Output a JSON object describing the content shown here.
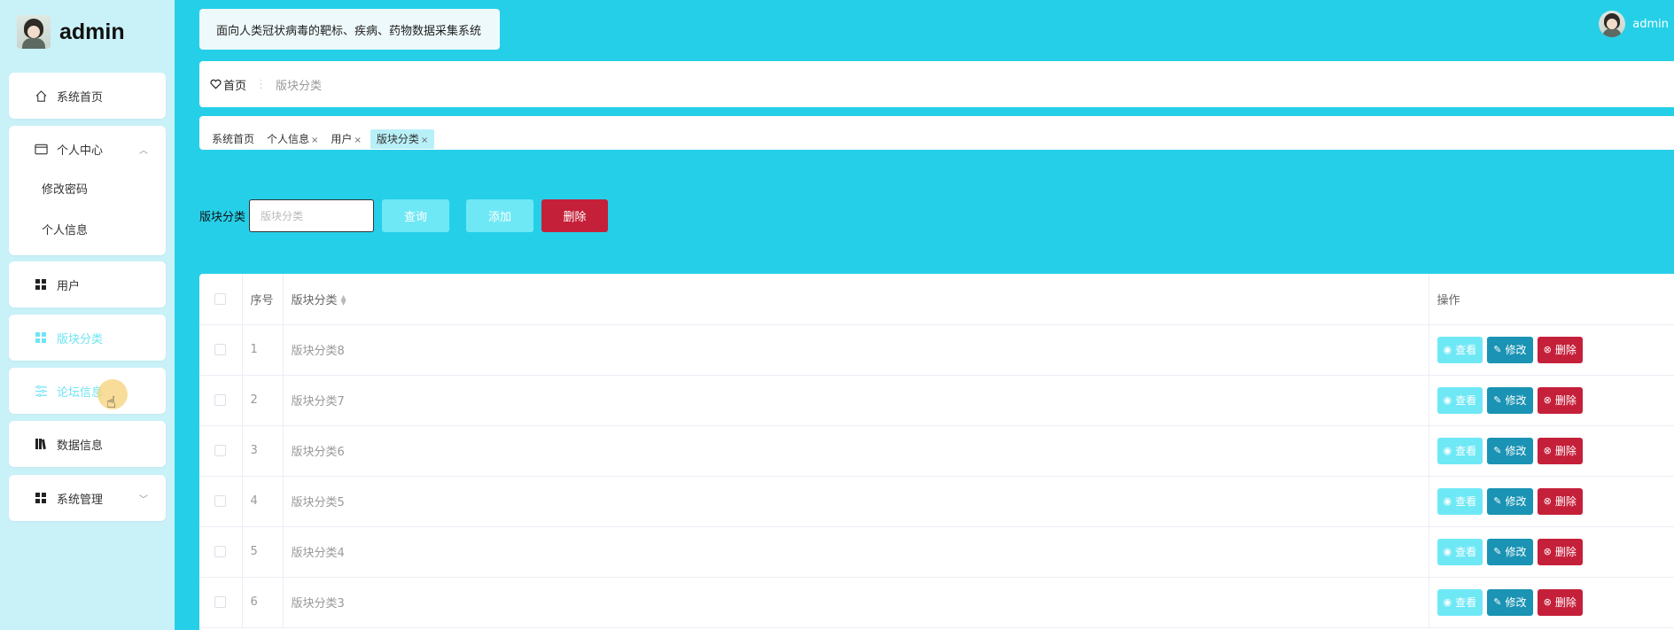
{
  "sidebar": {
    "brand_name": "admin",
    "items": [
      {
        "label": "系统首页"
      },
      {
        "label": "个人中心",
        "children": [
          {
            "label": "修改密码"
          },
          {
            "label": "个人信息"
          }
        ]
      },
      {
        "label": "用户"
      },
      {
        "label": "版块分类"
      },
      {
        "label": "论坛信息"
      },
      {
        "label": "数据信息"
      },
      {
        "label": "系统管理"
      }
    ]
  },
  "header": {
    "system_title": "面向人类冠状病毒的靶标、疾病、药物数据采集系统",
    "user_name": "admin"
  },
  "breadcrumb": {
    "home": "首页",
    "separator": "⋮",
    "current": "版块分类"
  },
  "tags": [
    {
      "label": "系统首页",
      "closable": false
    },
    {
      "label": "个人信息",
      "closable": true
    },
    {
      "label": "用户",
      "closable": true
    },
    {
      "label": "版块分类",
      "closable": true,
      "active": true
    }
  ],
  "search": {
    "label": "版块分类",
    "placeholder": "版块分类",
    "query_label": "查询",
    "add_label": "添加",
    "delete_label": "删除"
  },
  "table": {
    "headers": {
      "index": "序号",
      "name": "版块分类",
      "ops": "操作"
    },
    "rows": [
      {
        "index": "1",
        "name": "版块分类8"
      },
      {
        "index": "2",
        "name": "版块分类7"
      },
      {
        "index": "3",
        "name": "版块分类6"
      },
      {
        "index": "4",
        "name": "版块分类5"
      },
      {
        "index": "5",
        "name": "版块分类4"
      },
      {
        "index": "6",
        "name": "版块分类3"
      }
    ],
    "row_actions": {
      "view": "查看",
      "edit": "修改",
      "delete": "删除"
    }
  },
  "colors": {
    "accent": "#26cfe8",
    "sidebar_bg": "#c9f1f8",
    "light_button": "#6fe8f6",
    "edit_button": "#1a93b4",
    "danger": "#c5203a"
  }
}
